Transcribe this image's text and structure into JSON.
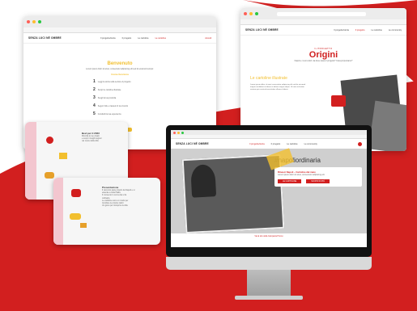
{
  "colors": {
    "red": "#d21f1f",
    "yellow": "#f2bf2e",
    "dark": "#1a1a1a"
  },
  "left_window": {
    "brand": "SENZA LUCI NÉ OMBRE",
    "menu": [
      "Il progetto/storia",
      "Il progetto",
      "Le cartoline",
      "Le cartoline"
    ],
    "cta": "Accedi",
    "heading": "Benvenuto",
    "intro": "Lorem ipsum dolor sit amet, consectetur adipiscing elit sed do eiusmod tempor.",
    "section": "Come funziona",
    "steps": [
      "Leggi la storia nella sezione il progetto",
      "Scopri le cartoline illustrate",
      "Scegli la tua preferita",
      "Segui il link e riassumi il tuo ricordo",
      "Condividi la tua esperienza"
    ],
    "button": "Inizia ora"
  },
  "right_window": {
    "brand": "SENZA LUCI NÉ OMBRE",
    "menu": [
      "Il progetto/storia",
      "Il progetto",
      "Le cartoline",
      "Le community"
    ],
    "kicker": "IL PROGETTO",
    "title": "Origini",
    "subtitle": "Napoli e i suoi colori: da dove nasce il progetto? Cosa proponiamo?",
    "section_title": "Le cartoline illustrate",
    "body": "Lorem ipsum dolor sit amet consectetur adipiscing elit sed do eiusmod tempor incididunt ut labore et dolore magna aliqua. Ut enim ad minim veniam quis nostrud exercitation ullamco laboris."
  },
  "mac": {
    "brand": "SENZA LUCI NÉ OMBRE",
    "menu": [
      "Il progetto/storia",
      "Il progetto",
      "Le cartoline",
      "Le community"
    ],
    "hashtag": "#napoliordinaria",
    "card_title": "Rinasci Napoli – Cartoline dal mare",
    "card_text": "Lorem ipsum dolor sit amet, consectetur adipiscing elit.",
    "btn1": "LE CARTOLINE",
    "btn2": "SCOPRI DI PIÙ",
    "footer_link": "Vai al sito della Campania Promo"
  },
  "tablet_back": {
    "title": "Bevi per il 2023",
    "lines": [
      "Ricorda le tue origini",
      "e scopri i luoghi segreti",
      "nel cuore della città"
    ]
  },
  "tablet_front": {
    "title": "Presentazione",
    "lines": [
      "Il racconto parte proprio da Napoli e si",
      "estende a tutta l'Italia",
      "Il momento in cui la vita si fa",
      "ordinaria",
      "Le cartoline sono un modo per",
      "ricordare le proprie radici",
      "Un gioco per riscoprire la città"
    ]
  }
}
